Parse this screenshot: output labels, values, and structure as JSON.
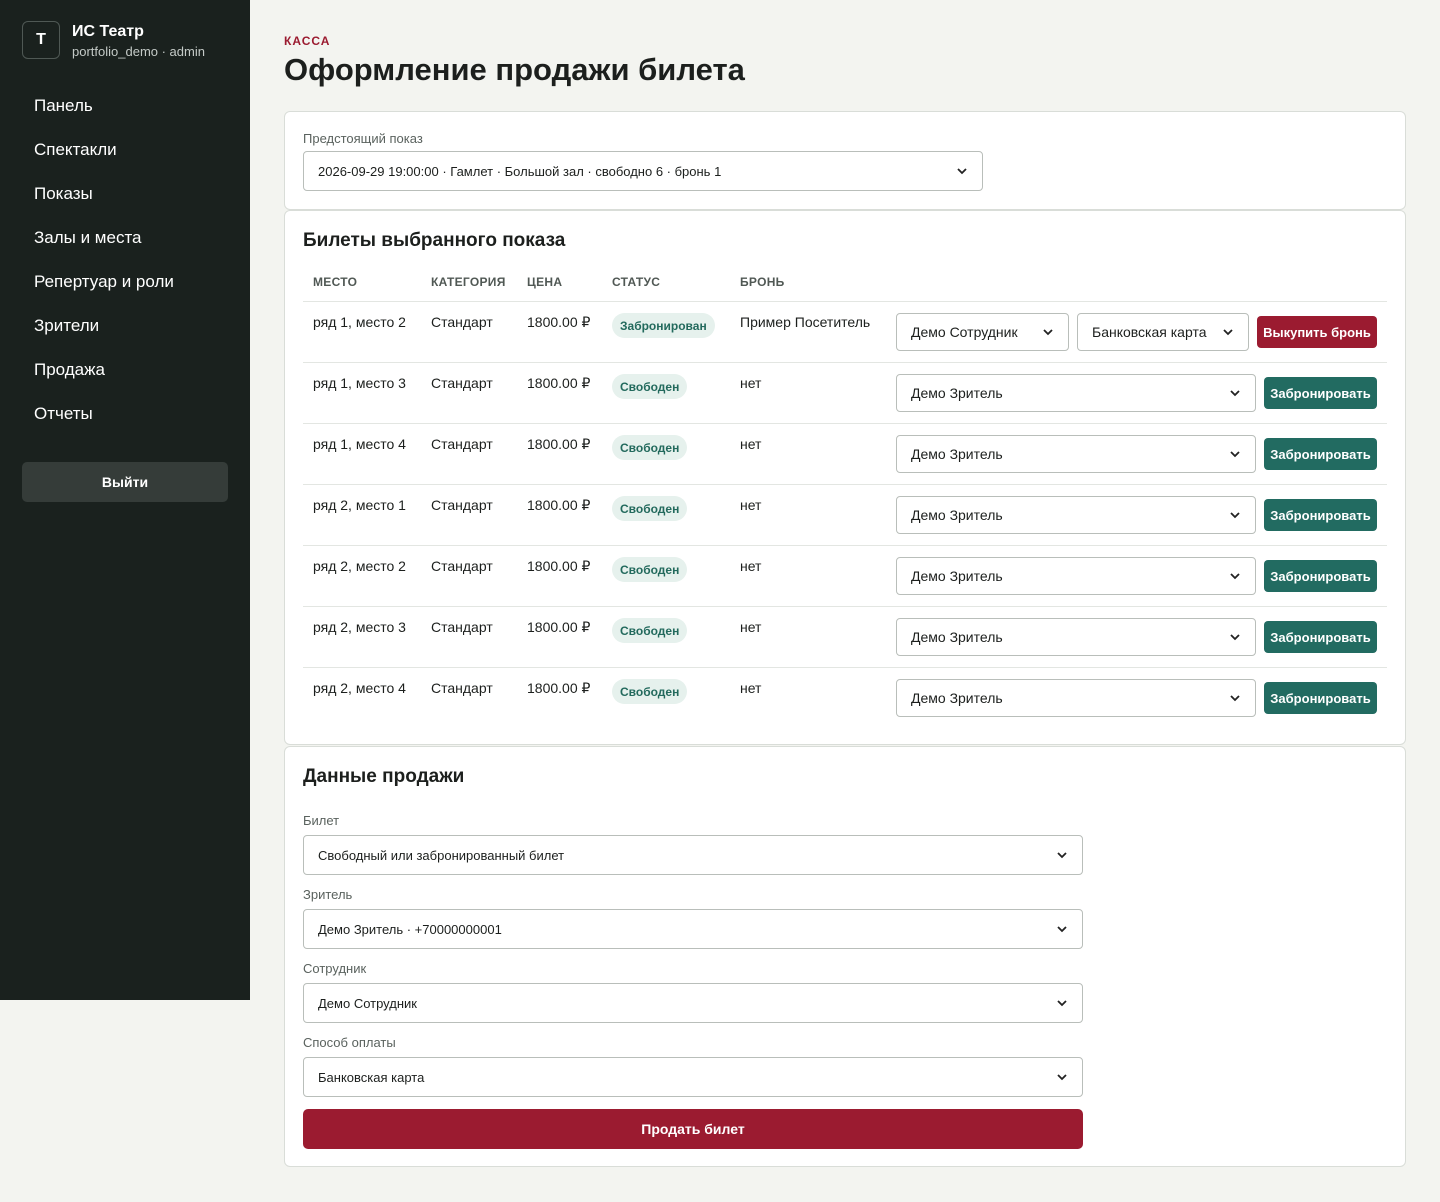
{
  "brand": {
    "logo_letter": "Т",
    "title": "ИС Театр",
    "subtitle": "portfolio_demo · admin"
  },
  "nav": {
    "items": [
      {
        "label": "Панель"
      },
      {
        "label": "Спектакли"
      },
      {
        "label": "Показы"
      },
      {
        "label": "Залы и места"
      },
      {
        "label": "Репертуар и роли"
      },
      {
        "label": "Зрители"
      },
      {
        "label": "Продажа"
      },
      {
        "label": "Отчеты"
      }
    ],
    "logout": "Выйти"
  },
  "header": {
    "eyebrow": "Касса",
    "title": "Оформление продажи билета"
  },
  "show_select": {
    "label": "Предстоящий показ",
    "value": "2026-09-29 19:00:00 · Гамлет · Большой зал · свободно 6 · бронь 1"
  },
  "tickets": {
    "title": "Билеты выбранного показа",
    "columns": [
      "Место",
      "Категория",
      "Цена",
      "Статус",
      "Бронь"
    ],
    "rows": [
      {
        "seat": "ряд 1, место 2",
        "category": "Стандарт",
        "price": "1800.00 ₽",
        "status": "Забронирован",
        "booking": "Пример Посетитель",
        "employee": "Демо Сотрудник",
        "payment": "Банковская карта",
        "action": "Выкупить бронь"
      },
      {
        "seat": "ряд 1, место 3",
        "category": "Стандарт",
        "price": "1800.00 ₽",
        "status": "Свободен",
        "booking": "нет",
        "viewer": "Демо Зритель",
        "action": "Забронировать"
      },
      {
        "seat": "ряд 1, место 4",
        "category": "Стандарт",
        "price": "1800.00 ₽",
        "status": "Свободен",
        "booking": "нет",
        "viewer": "Демо Зритель",
        "action": "Забронировать"
      },
      {
        "seat": "ряд 2, место 1",
        "category": "Стандарт",
        "price": "1800.00 ₽",
        "status": "Свободен",
        "booking": "нет",
        "viewer": "Демо Зритель",
        "action": "Забронировать"
      },
      {
        "seat": "ряд 2, место 2",
        "category": "Стандарт",
        "price": "1800.00 ₽",
        "status": "Свободен",
        "booking": "нет",
        "viewer": "Демо Зритель",
        "action": "Забронировать"
      },
      {
        "seat": "ряд 2, место 3",
        "category": "Стандарт",
        "price": "1800.00 ₽",
        "status": "Свободен",
        "booking": "нет",
        "viewer": "Демо Зритель",
        "action": "Забронировать"
      },
      {
        "seat": "ряд 2, место 4",
        "category": "Стандарт",
        "price": "1800.00 ₽",
        "status": "Свободен",
        "booking": "нет",
        "viewer": "Демо Зритель",
        "action": "Забронировать"
      }
    ]
  },
  "sale": {
    "title": "Данные продажи",
    "ticket": {
      "label": "Билет",
      "value": "Свободный или забронированный билет"
    },
    "viewer": {
      "label": "Зритель",
      "value": "Демо Зритель · +70000000001"
    },
    "employee": {
      "label": "Сотрудник",
      "value": "Демо Сотрудник"
    },
    "payment": {
      "label": "Способ оплаты",
      "value": "Банковская карта"
    },
    "submit": "Продать билет"
  },
  "colors": {
    "sidebar": "#1a211e",
    "accent_red": "#9b1b30",
    "accent_teal": "#226b61",
    "badge_bg": "#e6f1ed"
  }
}
